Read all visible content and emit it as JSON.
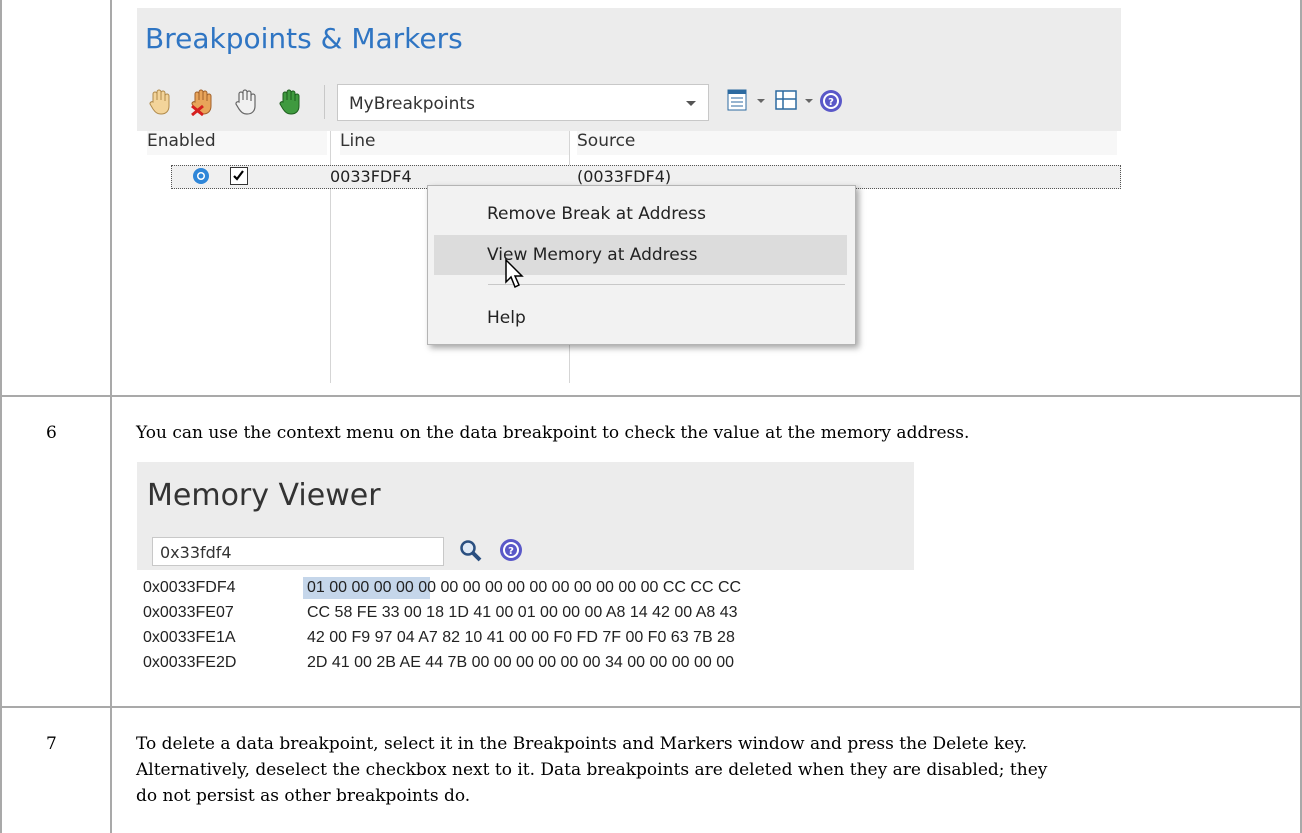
{
  "breakpoints_window": {
    "title": "Breakpoints & Markers",
    "toolbar": {
      "icons": [
        "hand-add-icon",
        "hand-delete-icon",
        "hand-disable-icon",
        "hand-enable-icon"
      ],
      "set_selector_value": "MyBreakpoints",
      "extra_icons": [
        "list-view-icon",
        "layout-icon",
        "help-icon"
      ]
    },
    "columns": [
      "Enabled",
      "Line",
      "Source"
    ],
    "rows": [
      {
        "enabled": true,
        "line": "0033FDF4",
        "source": "(0033FDF4)"
      }
    ]
  },
  "context_menu": {
    "items": [
      "Remove Break at Address",
      "View Memory at Address",
      "Help"
    ],
    "hovered_index": 1
  },
  "steps": [
    {
      "number": "6",
      "text": "You can use the context menu on the data breakpoint to check the value at the memory address."
    },
    {
      "number": "7",
      "lines": [
        "To delete a data breakpoint, select it in the Breakpoints and Markers window and press the Delete key.",
        "Alternatively, deselect the checkbox next to it. Data breakpoints are deleted when they are disabled; they",
        "do not persist as other breakpoints do."
      ]
    }
  ],
  "memory_viewer": {
    "title": "Memory Viewer",
    "address_input": "0x33fdf4",
    "rows": [
      {
        "address": "0x0033FDF4",
        "bytes": "01 00 00 00 00 00 00 00 00 00 00 00 00 00 00 00 CC CC CC"
      },
      {
        "address": "0x0033FE07",
        "bytes": "CC 58 FE 33 00 18 1D 41 00 01 00 00 00 A8 14 42 00 A8 43"
      },
      {
        "address": "0x0033FE1A",
        "bytes": "42 00 F9 97 04 A7 82 10 41 00 00 F0 FD 7F 00 F0 63 7B 28"
      },
      {
        "address": "0x0033FE2D",
        "bytes": "2D 41 00 2B AE 44 7B 00 00 00 00 00 00 34 00 00 00 00 00"
      }
    ]
  },
  "colors": {
    "title_blue": "#2f75c3",
    "highlight": "#c5d6ea",
    "table_border": "#a9a9a9"
  }
}
